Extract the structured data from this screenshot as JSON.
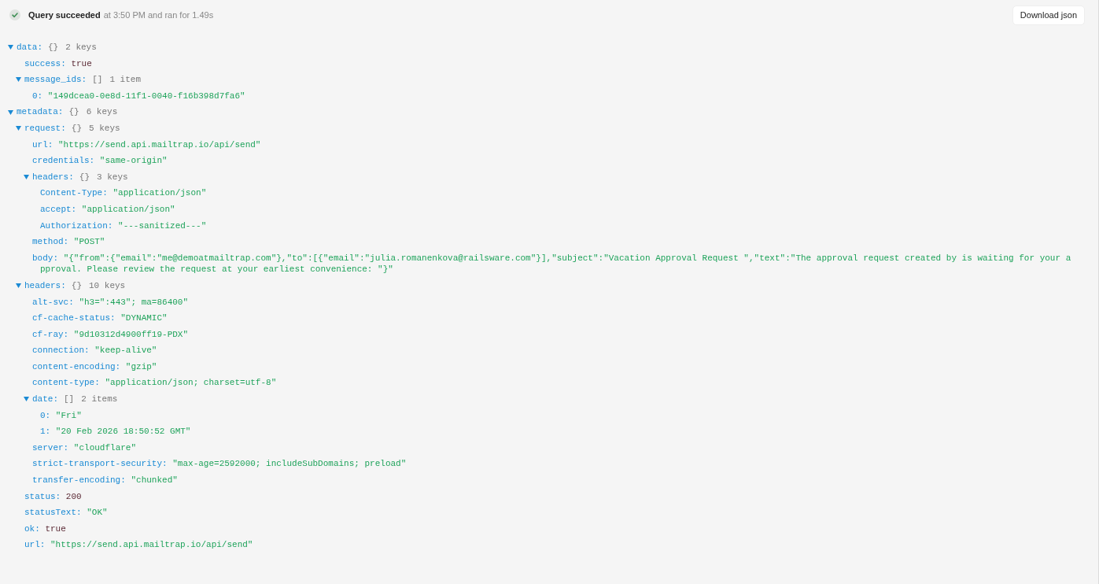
{
  "header": {
    "status_title": "Query succeeded",
    "status_detail": "at 3:50 PM and ran for 1.49s",
    "download_button": "Download json"
  },
  "tree": [
    {
      "key": "data:",
      "kind": "group",
      "expanded": true,
      "brackets": "{}",
      "summary": "2 keys",
      "children": [
        {
          "key": "success:",
          "kind": "literal",
          "value": "true"
        },
        {
          "key": "message_ids:",
          "kind": "group",
          "expanded": true,
          "brackets": "[]",
          "summary": "1 item",
          "children": [
            {
              "key": "0:",
              "kind": "string",
              "value": "\"149dcea0-0e8d-11f1-0040-f16b398d7fa6\""
            }
          ]
        }
      ]
    },
    {
      "key": "metadata:",
      "kind": "group",
      "expanded": true,
      "brackets": "{}",
      "summary": "6 keys",
      "children": [
        {
          "key": "request:",
          "kind": "group",
          "expanded": true,
          "brackets": "{}",
          "summary": "5 keys",
          "children": [
            {
              "key": "url:",
              "kind": "string",
              "value": "\"https://send.api.mailtrap.io/api/send\""
            },
            {
              "key": "credentials:",
              "kind": "string",
              "value": "\"same-origin\""
            },
            {
              "key": "headers:",
              "kind": "group",
              "expanded": true,
              "brackets": "{}",
              "summary": "3 keys",
              "children": [
                {
                  "key": "Content-Type:",
                  "kind": "string",
                  "value": "\"application/json\""
                },
                {
                  "key": "accept:",
                  "kind": "string",
                  "value": "\"application/json\""
                },
                {
                  "key": "Authorization:",
                  "kind": "string",
                  "value": "\"---sanitized---\""
                }
              ]
            },
            {
              "key": "method:",
              "kind": "string",
              "value": "\"POST\""
            },
            {
              "key": "body:",
              "kind": "string",
              "value": "\"{\"from\":{\"email\":\"me@demoatmailtrap.com\"},\"to\":[{\"email\":\"julia.romanenkova@railsware.com\"}],\"subject\":\"Vacation Approval Request \",\"text\":\"The approval request created by is waiting for your approval. Please review the request at your earliest convenience: \"}\""
            }
          ]
        },
        {
          "key": "headers:",
          "kind": "group",
          "expanded": true,
          "brackets": "{}",
          "summary": "10 keys",
          "children": [
            {
              "key": "alt-svc:",
              "kind": "string",
              "value": "\"h3=\":443\"; ma=86400\""
            },
            {
              "key": "cf-cache-status:",
              "kind": "string",
              "value": "\"DYNAMIC\""
            },
            {
              "key": "cf-ray:",
              "kind": "string",
              "value": "\"9d10312d4900ff19-PDX\""
            },
            {
              "key": "connection:",
              "kind": "string",
              "value": "\"keep-alive\""
            },
            {
              "key": "content-encoding:",
              "kind": "string",
              "value": "\"gzip\""
            },
            {
              "key": "content-type:",
              "kind": "string",
              "value": "\"application/json; charset=utf-8\""
            },
            {
              "key": "date:",
              "kind": "group",
              "expanded": true,
              "brackets": "[]",
              "summary": "2 items",
              "children": [
                {
                  "key": "0:",
                  "kind": "string",
                  "value": "\"Fri\""
                },
                {
                  "key": "1:",
                  "kind": "string",
                  "value": "\"20 Feb 2026 18:50:52 GMT\""
                }
              ]
            },
            {
              "key": "server:",
              "kind": "string",
              "value": "\"cloudflare\""
            },
            {
              "key": "strict-transport-security:",
              "kind": "string",
              "value": "\"max-age=2592000; includeSubDomains; preload\""
            },
            {
              "key": "transfer-encoding:",
              "kind": "string",
              "value": "\"chunked\""
            }
          ]
        },
        {
          "key": "status:",
          "kind": "literal",
          "value": "200"
        },
        {
          "key": "statusText:",
          "kind": "string",
          "value": "\"OK\""
        },
        {
          "key": "ok:",
          "kind": "literal",
          "value": "true"
        },
        {
          "key": "url:",
          "kind": "string",
          "value": "\"https://send.api.mailtrap.io/api/send\""
        }
      ]
    }
  ]
}
